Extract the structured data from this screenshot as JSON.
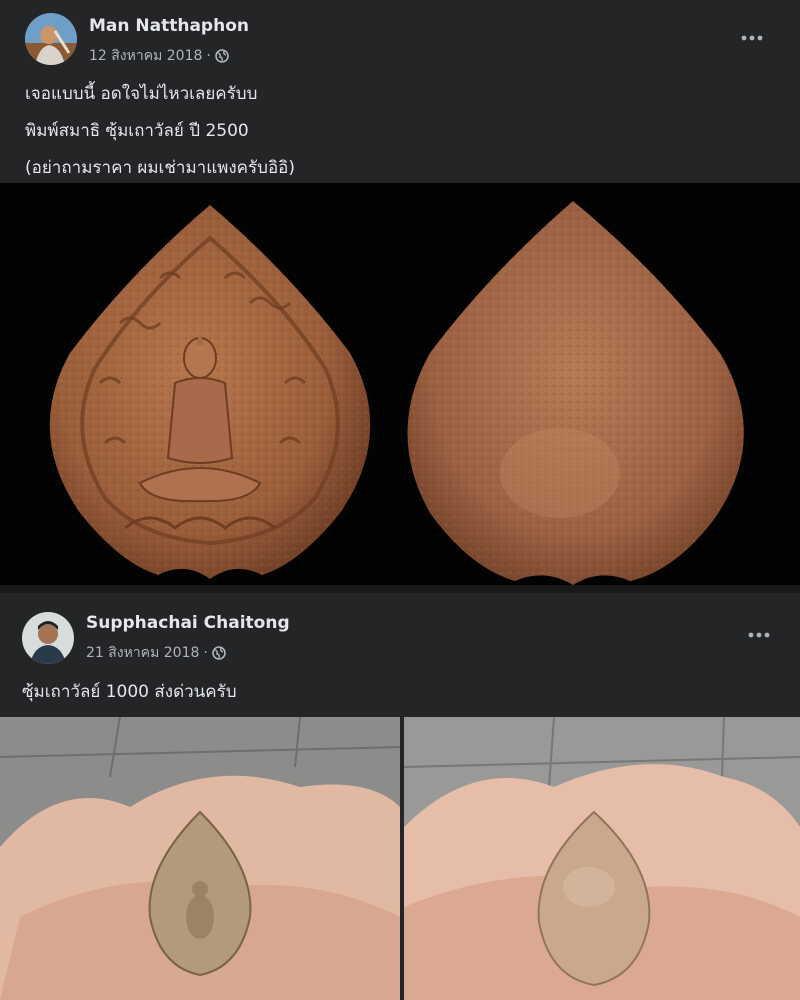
{
  "posts": [
    {
      "author": "Man Natthaphon",
      "date": "12 สิงหาคม 2018",
      "separator": "·",
      "lines": [
        "เจอแบบนี้ อดใจไม่ไหวเลยครับบ",
        "พิมพ์สมาธิ ซุ้มเถาวัลย์ ปี 2500",
        "(อย่าถามราคา ผมเช่ามาแพงครับอิอิ)"
      ],
      "privacy_icon": "globe-icon",
      "menu_icon": "more-options-icon"
    },
    {
      "author": "Supphachai Chaitong",
      "date": "21 สิงหาคม 2018",
      "separator": "·",
      "lines": [
        "ซุ้มเถาวัลย์ 1000 ส่งด่วนครับ"
      ],
      "privacy_icon": "globe-icon",
      "menu_icon": "more-options-icon"
    }
  ],
  "colors": {
    "page_bg": "#18191a",
    "card_bg": "#242526",
    "text_primary": "#e4e6eb",
    "text_secondary": "#b0b3b8"
  }
}
